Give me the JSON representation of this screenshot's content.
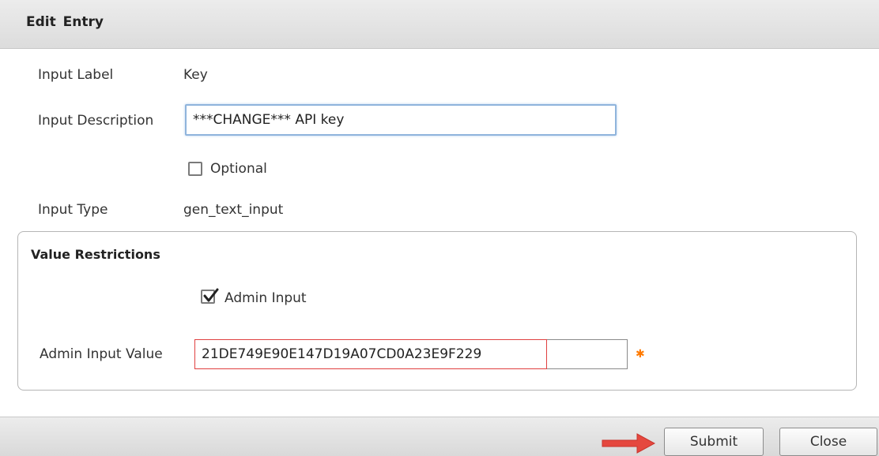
{
  "dialog": {
    "title": "Edit  Entry"
  },
  "form": {
    "input_label": {
      "label": "Input Label",
      "value": "Key"
    },
    "input_description": {
      "label": "Input Description",
      "value": "***CHANGE*** API key"
    },
    "optional": {
      "label": "Optional",
      "checked": false
    },
    "input_type": {
      "label": "Input Type",
      "value": "gen_text_input"
    }
  },
  "restrictions": {
    "title": "Value Restrictions",
    "admin_input": {
      "label": "Admin Input",
      "checked": true
    },
    "admin_input_value": {
      "label": "Admin Input Value",
      "value": "21DE749E90E147D19A07CD0A23E9F229"
    },
    "required_marker": "✱"
  },
  "footer": {
    "submit_label": "Submit",
    "close_label": "Close"
  },
  "colors": {
    "required": "#ff7a00",
    "arrow": "#e5483f",
    "error_border": "#e04040",
    "focus_border": "#8fb4dc"
  }
}
